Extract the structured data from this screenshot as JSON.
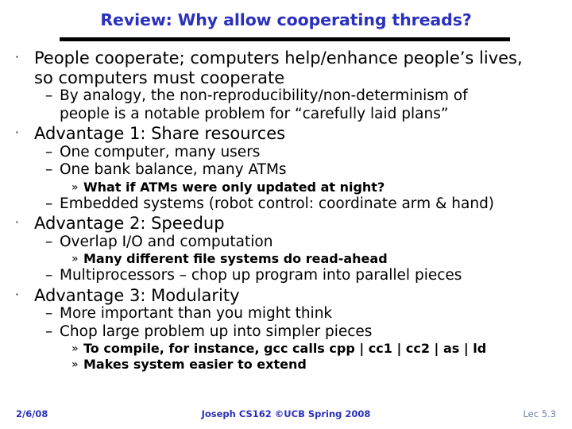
{
  "slide": {
    "title": "Review: Why allow cooperating threads?",
    "title_color": "#2B30BD",
    "rule_color": "#000000",
    "background": "#ffffff",
    "markers": {
      "level1": "·",
      "level2": "–",
      "level3": "»"
    },
    "bullets": [
      {
        "level": 1,
        "lines": [
          "People cooperate; computers help/enhance people’s lives,",
          "so computers must cooperate"
        ]
      },
      {
        "level": 2,
        "lines": [
          "By analogy, the non-reproducibility/non-determinism of",
          "people is a notable problem for “carefully laid plans”"
        ]
      },
      {
        "level": 1,
        "lines": [
          "Advantage 1: Share resources"
        ]
      },
      {
        "level": 2,
        "lines": [
          "One computer, many users"
        ]
      },
      {
        "level": 2,
        "lines": [
          "One bank balance, many ATMs"
        ]
      },
      {
        "level": 3,
        "lines": [
          "What if ATMs were only updated at night?"
        ]
      },
      {
        "level": 2,
        "lines": [
          "Embedded systems (robot control: coordinate arm & hand)"
        ]
      },
      {
        "level": 1,
        "lines": [
          "Advantage 2: Speedup"
        ]
      },
      {
        "level": 2,
        "lines": [
          "Overlap I/O and computation"
        ]
      },
      {
        "level": 3,
        "lines": [
          "Many different file systems do read-ahead"
        ]
      },
      {
        "level": 2,
        "lines": [
          "Multiprocessors – chop up program into parallel pieces"
        ]
      },
      {
        "level": 1,
        "lines": [
          "Advantage 3: Modularity"
        ]
      },
      {
        "level": 2,
        "lines": [
          "More important than you might think"
        ]
      },
      {
        "level": 2,
        "lines": [
          "Chop large problem up into simpler pieces"
        ]
      },
      {
        "level": 3,
        "lines": [
          "To compile, for instance, gcc calls cpp | cc1 | cc2 | as | ld"
        ]
      },
      {
        "level": 3,
        "lines": [
          "Makes system easier to extend"
        ]
      }
    ]
  },
  "footer": {
    "date": "2/6/08",
    "attribution": "Joseph CS162 ©UCB Spring 2008",
    "lecture": "Lec 5.3",
    "accent_color": "#2B30BD",
    "muted_color": "#6E7EA8"
  }
}
